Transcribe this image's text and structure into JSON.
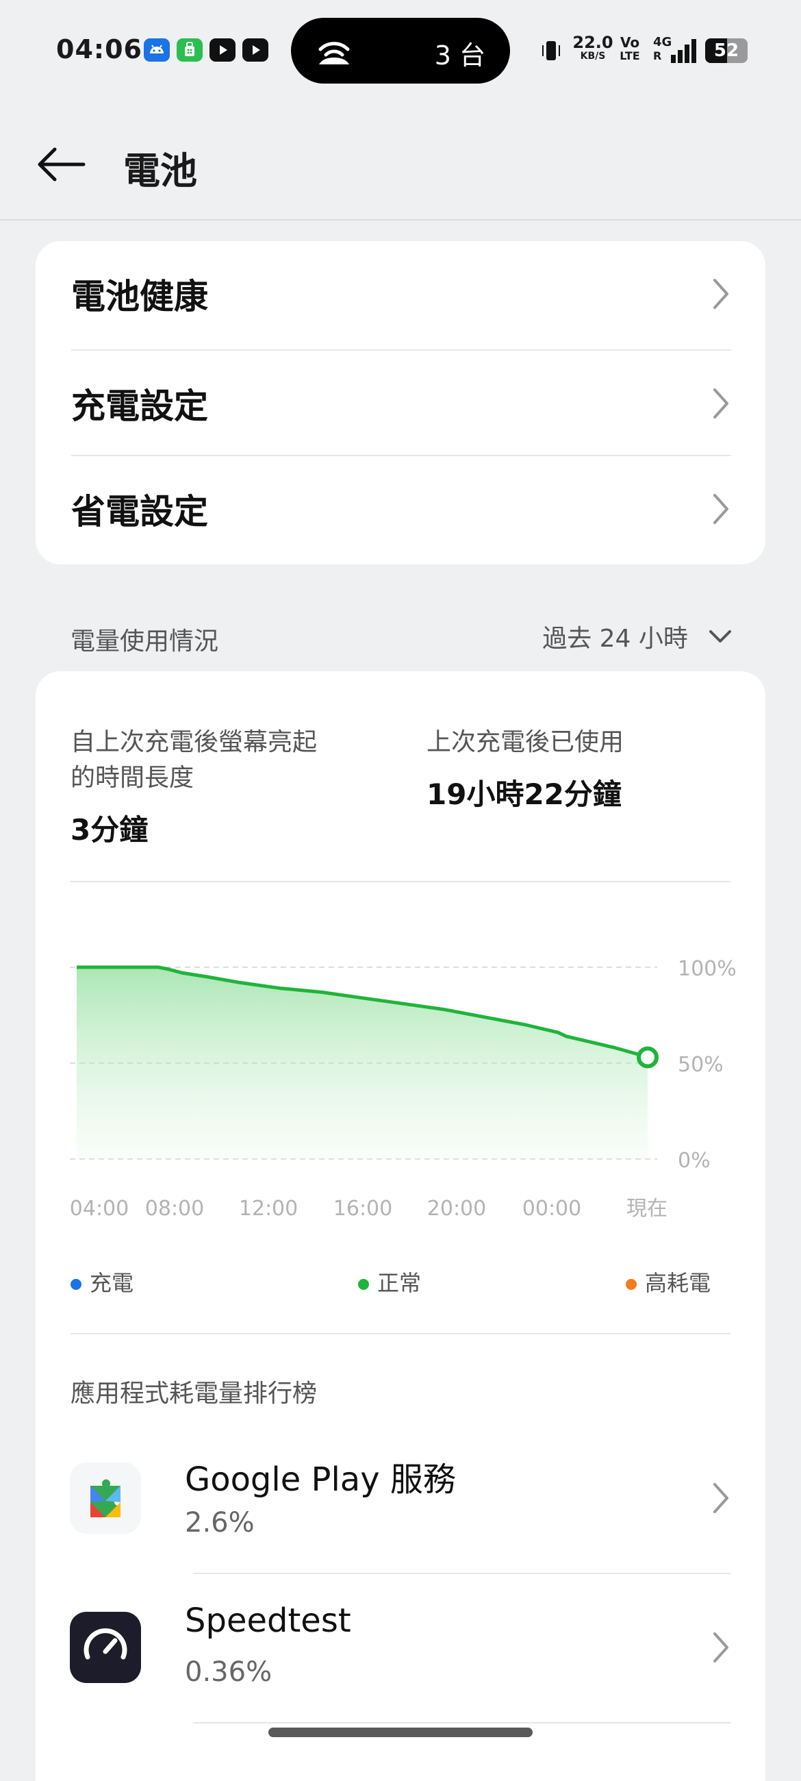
{
  "status_bar": {
    "time": "04:06",
    "island_count": "3 台",
    "net_speed": "22.0",
    "net_unit": "KB/S",
    "volte_top": "Vo",
    "volte_bottom": "LTE",
    "network_gen": "4G",
    "roaming": "R",
    "battery": "52",
    "app_icons": [
      "android-icon",
      "store-icon",
      "youtube-icon",
      "youtube-icon"
    ]
  },
  "header": {
    "title": "電池"
  },
  "settings_menu": {
    "items": [
      {
        "label": "電池健康"
      },
      {
        "label": "充電設定"
      },
      {
        "label": "省電設定"
      }
    ]
  },
  "usage": {
    "section_title": "電量使用情況",
    "range_label": "過去 24 小時",
    "screen_on_label": "自上次充電後螢幕亮起的時間長度",
    "screen_on_line1": "自上次充電後螢幕亮起",
    "screen_on_line2": "的時間長度",
    "screen_on_value": "3分鐘",
    "since_charge_label": "上次充電後已使用",
    "since_charge_value": "19小時22分鐘"
  },
  "chart_data": {
    "type": "area",
    "x": [
      "04:00",
      "08:00",
      "12:00",
      "16:00",
      "20:00",
      "00:00",
      "現在"
    ],
    "y_tick_labels": [
      "100%",
      "50%",
      "0%"
    ],
    "ylim": [
      0,
      100
    ],
    "series": [
      {
        "name": "正常",
        "color": "#1fb43a",
        "points": [
          [
            0,
            100
          ],
          [
            1,
            100
          ],
          [
            1.12,
            99
          ],
          [
            1.3,
            97
          ],
          [
            1.6,
            95
          ],
          [
            2,
            92
          ],
          [
            2.5,
            89
          ],
          [
            3,
            87
          ],
          [
            3.5,
            84
          ],
          [
            4,
            81
          ],
          [
            4.5,
            78
          ],
          [
            5,
            74
          ],
          [
            5.5,
            70
          ],
          [
            5.9,
            66
          ],
          [
            6,
            64
          ],
          [
            6.3,
            61
          ],
          [
            6.6,
            58
          ],
          [
            6.85,
            55
          ],
          [
            7,
            53
          ]
        ]
      }
    ],
    "x_positions_note_units": "hours/4 from 04:00",
    "grid": true,
    "end_marker": true
  },
  "legend": [
    {
      "label": "充電",
      "color": "#1a73e8"
    },
    {
      "label": "正常",
      "color": "#1fb43a"
    },
    {
      "label": "高耗電",
      "color": "#f27c1c"
    }
  ],
  "ranking": {
    "title": "應用程式耗電量排行榜",
    "apps": [
      {
        "name": "Google Play 服務",
        "percent": "2.6%",
        "icon": "google-play-services-icon"
      },
      {
        "name": "Speedtest",
        "percent": "0.36%",
        "icon": "speedtest-icon"
      }
    ]
  }
}
